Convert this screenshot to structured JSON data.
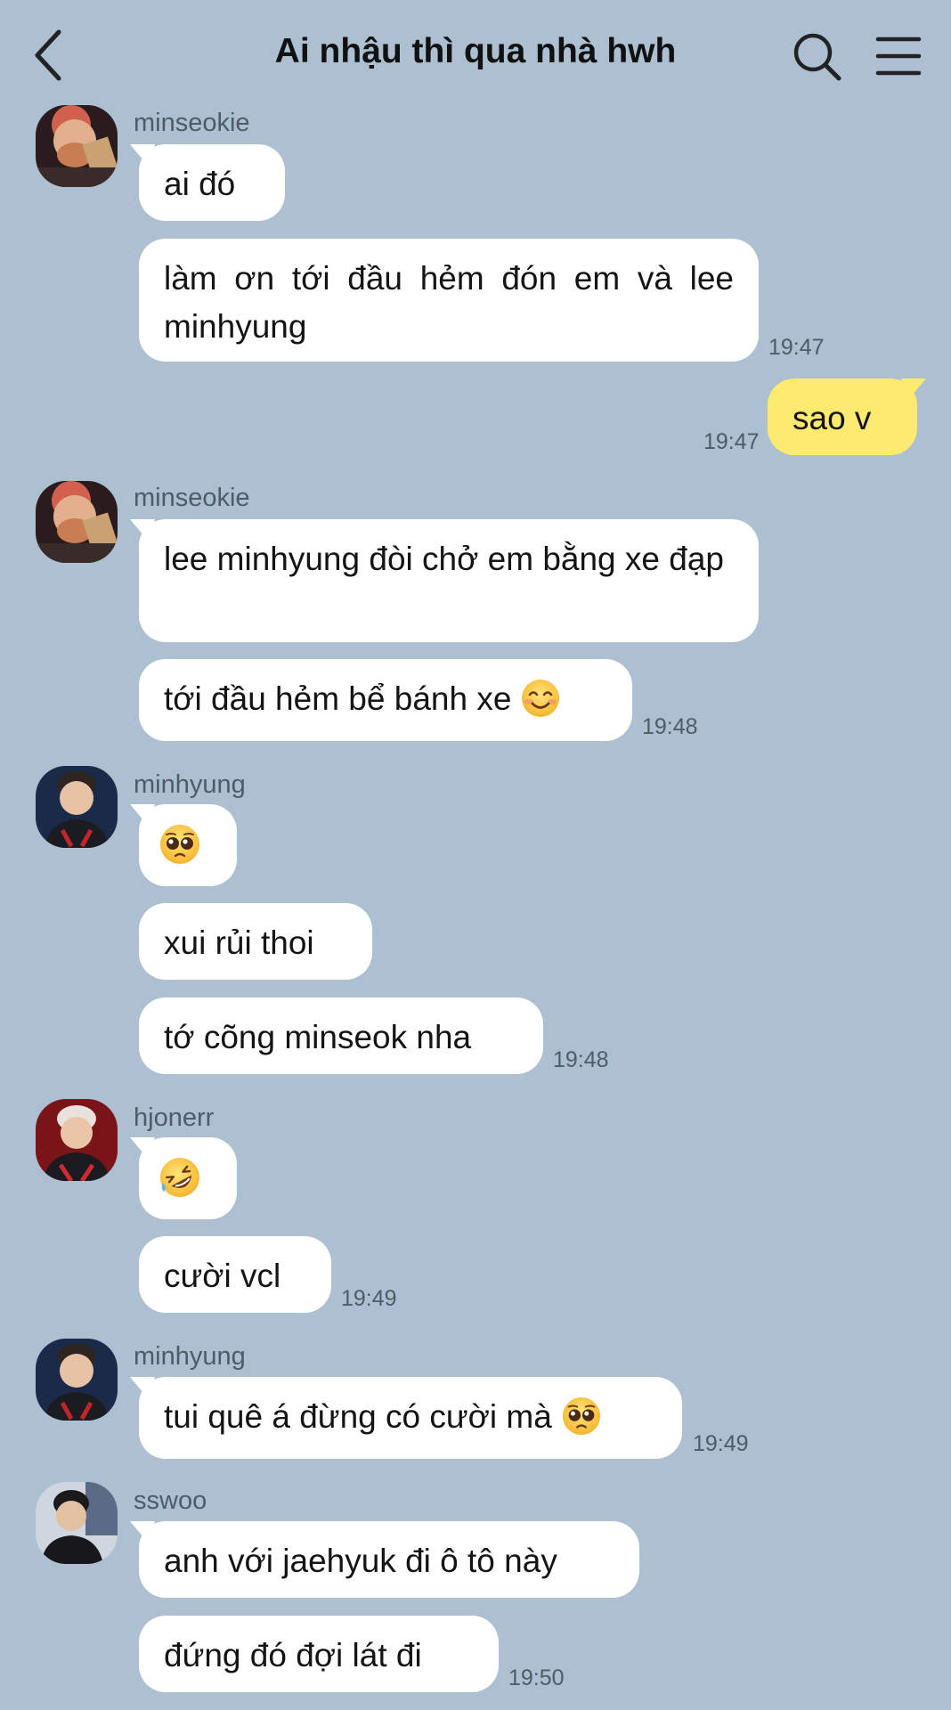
{
  "header": {
    "title": "Ai nhậu thì qua nhà hwh",
    "back_icon": "chevron-left-icon",
    "search_icon": "search-icon",
    "menu_icon": "hamburger-menu-icon"
  },
  "colors": {
    "background": "#adc0d2",
    "bubble_other": "#ffffff",
    "bubble_me": "#fdea6e",
    "meta_text": "#4f5b66"
  },
  "messages": [
    {
      "sender": "minseokie",
      "text": "ai đó"
    },
    {
      "sender": "minseokie",
      "text": "làm ơn tới đầu hẻm đón em và lee minhyung",
      "time": "19:47"
    },
    {
      "sender": "me",
      "text": "sao v",
      "time": "19:47"
    },
    {
      "sender": "minseokie",
      "text": "lee minhyung đòi chở em bằng xe đạp"
    },
    {
      "sender": "minseokie",
      "text": "tới đầu hẻm bể bánh xe",
      "emoji": "smiling-face-emoji",
      "time": "19:48"
    },
    {
      "sender": "minhyung",
      "emoji": "pleading-face-emoji"
    },
    {
      "sender": "minhyung",
      "text": "xui rủi thoi"
    },
    {
      "sender": "minhyung",
      "text": "tớ cõng minseok nha",
      "time": "19:48"
    },
    {
      "sender": "hjonerr",
      "emoji": "rolling-laughing-emoji"
    },
    {
      "sender": "hjonerr",
      "text": "cười vcl",
      "time": "19:49"
    },
    {
      "sender": "minhyung",
      "text": "tui quê á đừng có cười mà",
      "emoji": "pleading-face-emoji",
      "time": "19:49"
    },
    {
      "sender": "sswoo",
      "text": "anh với jaehyuk đi ô tô này"
    },
    {
      "sender": "sswoo",
      "text": "đứng đó đợi lát đi",
      "time": "19:50"
    }
  ]
}
